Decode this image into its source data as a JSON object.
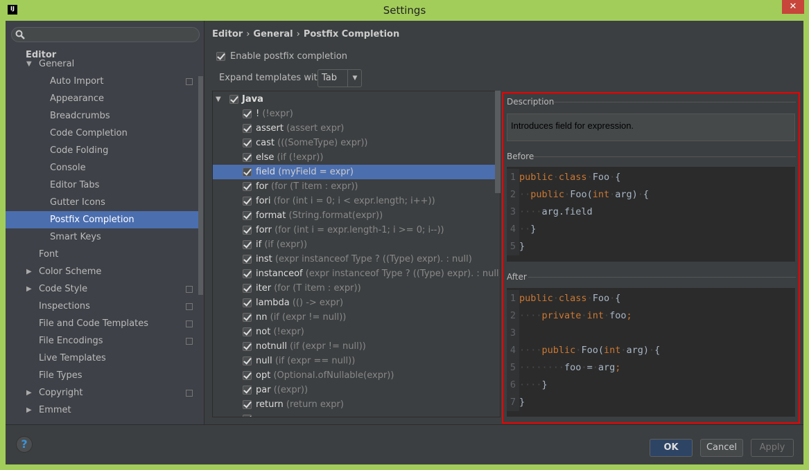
{
  "window": {
    "title": "Settings",
    "logo": "IJ",
    "close": "✕"
  },
  "sidebar": {
    "search_placeholder": "",
    "items": [
      {
        "label": "Editor",
        "level": 0,
        "bold": true
      },
      {
        "label": "General",
        "level": 1,
        "arrow": "expanded"
      },
      {
        "label": "Auto Import",
        "level": 2,
        "copy": true
      },
      {
        "label": "Appearance",
        "level": 2
      },
      {
        "label": "Breadcrumbs",
        "level": 2
      },
      {
        "label": "Code Completion",
        "level": 2
      },
      {
        "label": "Code Folding",
        "level": 2
      },
      {
        "label": "Console",
        "level": 2
      },
      {
        "label": "Editor Tabs",
        "level": 2
      },
      {
        "label": "Gutter Icons",
        "level": 2
      },
      {
        "label": "Postfix Completion",
        "level": 2,
        "selected": true
      },
      {
        "label": "Smart Keys",
        "level": 2
      },
      {
        "label": "Font",
        "level": 1
      },
      {
        "label": "Color Scheme",
        "level": 1,
        "arrow": "collapsed"
      },
      {
        "label": "Code Style",
        "level": 1,
        "arrow": "collapsed",
        "copy": true
      },
      {
        "label": "Inspections",
        "level": 1,
        "copy": true
      },
      {
        "label": "File and Code Templates",
        "level": 1,
        "copy": true
      },
      {
        "label": "File Encodings",
        "level": 1,
        "copy": true
      },
      {
        "label": "Live Templates",
        "level": 1
      },
      {
        "label": "File Types",
        "level": 1
      },
      {
        "label": "Copyright",
        "level": 1,
        "arrow": "collapsed",
        "copy": true
      },
      {
        "label": "Emmet",
        "level": 1,
        "arrow": "collapsed"
      }
    ]
  },
  "breadcrumb": {
    "items": [
      "Editor",
      "General",
      "Postfix Completion"
    ],
    "sep": "›"
  },
  "enable": {
    "label": "Enable postfix completion",
    "checked": true
  },
  "expand": {
    "label": "Expand templates with",
    "value": "Tab"
  },
  "templates": {
    "group": "Java",
    "rows": [
      [
        "!",
        "(!expr)"
      ],
      [
        "assert",
        "(assert expr)"
      ],
      [
        "cast",
        "(((SomeType) expr))"
      ],
      [
        "else",
        "(if (!expr))"
      ],
      [
        "field",
        "(myField = expr)"
      ],
      [
        "for",
        "(for (T item : expr))"
      ],
      [
        "fori",
        "(for (int i = 0; i < expr.length; i++))"
      ],
      [
        "format",
        "(String.format(expr))"
      ],
      [
        "forr",
        "(for (int i = expr.length-1; i >= 0; i--))"
      ],
      [
        "if",
        "(if (expr))"
      ],
      [
        "inst",
        "(expr instanceof Type ? ((Type) expr). : null)"
      ],
      [
        "instanceof",
        "(expr instanceof Type ? ((Type) expr). : null)"
      ],
      [
        "iter",
        "(for (T item : expr))"
      ],
      [
        "lambda",
        "(() -> expr)"
      ],
      [
        "nn",
        "(if (expr != null))"
      ],
      [
        "not",
        "(!expr)"
      ],
      [
        "notnull",
        "(if (expr != null))"
      ],
      [
        "null",
        "(if (expr == null))"
      ],
      [
        "opt",
        "(Optional.ofNullable(expr))"
      ],
      [
        "par",
        "((expr))"
      ],
      [
        "return",
        "(return expr)"
      ]
    ],
    "selected": "field"
  },
  "description": {
    "title": "Description",
    "text": "Introduces field for expression."
  },
  "before": {
    "title": "Before",
    "lines": [
      [
        [
          "kw",
          "public"
        ],
        [
          "ws",
          "·"
        ],
        [
          "kw",
          "class"
        ],
        [
          "ws",
          "·"
        ],
        [
          "id",
          "Foo"
        ],
        [
          "ws",
          "·"
        ],
        [
          "id",
          "{"
        ]
      ],
      [
        [
          "ws",
          "··"
        ],
        [
          "kw",
          "public"
        ],
        [
          "ws",
          "·"
        ],
        [
          "id",
          "Foo("
        ],
        [
          "kw",
          "int"
        ],
        [
          "ws",
          "·"
        ],
        [
          "id",
          "arg)"
        ],
        [
          "ws",
          "·"
        ],
        [
          "id",
          "{"
        ]
      ],
      [
        [
          "ws",
          "····"
        ],
        [
          "id",
          "arg.field"
        ]
      ],
      [
        [
          "ws",
          "··"
        ],
        [
          "id",
          "}"
        ]
      ],
      [
        [
          "id",
          "}"
        ]
      ]
    ]
  },
  "after": {
    "title": "After",
    "lines": [
      [
        [
          "kw",
          "public"
        ],
        [
          "ws",
          "·"
        ],
        [
          "kw",
          "class"
        ],
        [
          "ws",
          "·"
        ],
        [
          "id",
          "Foo"
        ],
        [
          "ws",
          "·"
        ],
        [
          "id",
          "{"
        ]
      ],
      [
        [
          "ws",
          "····"
        ],
        [
          "kw",
          "private"
        ],
        [
          "ws",
          "·"
        ],
        [
          "kw",
          "int"
        ],
        [
          "ws",
          "·"
        ],
        [
          "id",
          "foo"
        ],
        [
          "kw",
          ";"
        ]
      ],
      [],
      [
        [
          "ws",
          "····"
        ],
        [
          "kw",
          "public"
        ],
        [
          "ws",
          "·"
        ],
        [
          "id",
          "Foo("
        ],
        [
          "kw",
          "int"
        ],
        [
          "ws",
          "·"
        ],
        [
          "id",
          "arg)"
        ],
        [
          "ws",
          "·"
        ],
        [
          "id",
          "{"
        ]
      ],
      [
        [
          "ws",
          "········"
        ],
        [
          "id",
          "foo"
        ],
        [
          "ws",
          "·"
        ],
        [
          "id",
          "="
        ],
        [
          "ws",
          "·"
        ],
        [
          "id",
          "arg"
        ],
        [
          "kw",
          ";"
        ]
      ],
      [
        [
          "ws",
          "····"
        ],
        [
          "id",
          "}"
        ]
      ],
      [
        [
          "id",
          "}"
        ]
      ]
    ]
  },
  "buttons": {
    "ok": "OK",
    "cancel": "Cancel",
    "apply": "Apply",
    "help": "?"
  }
}
